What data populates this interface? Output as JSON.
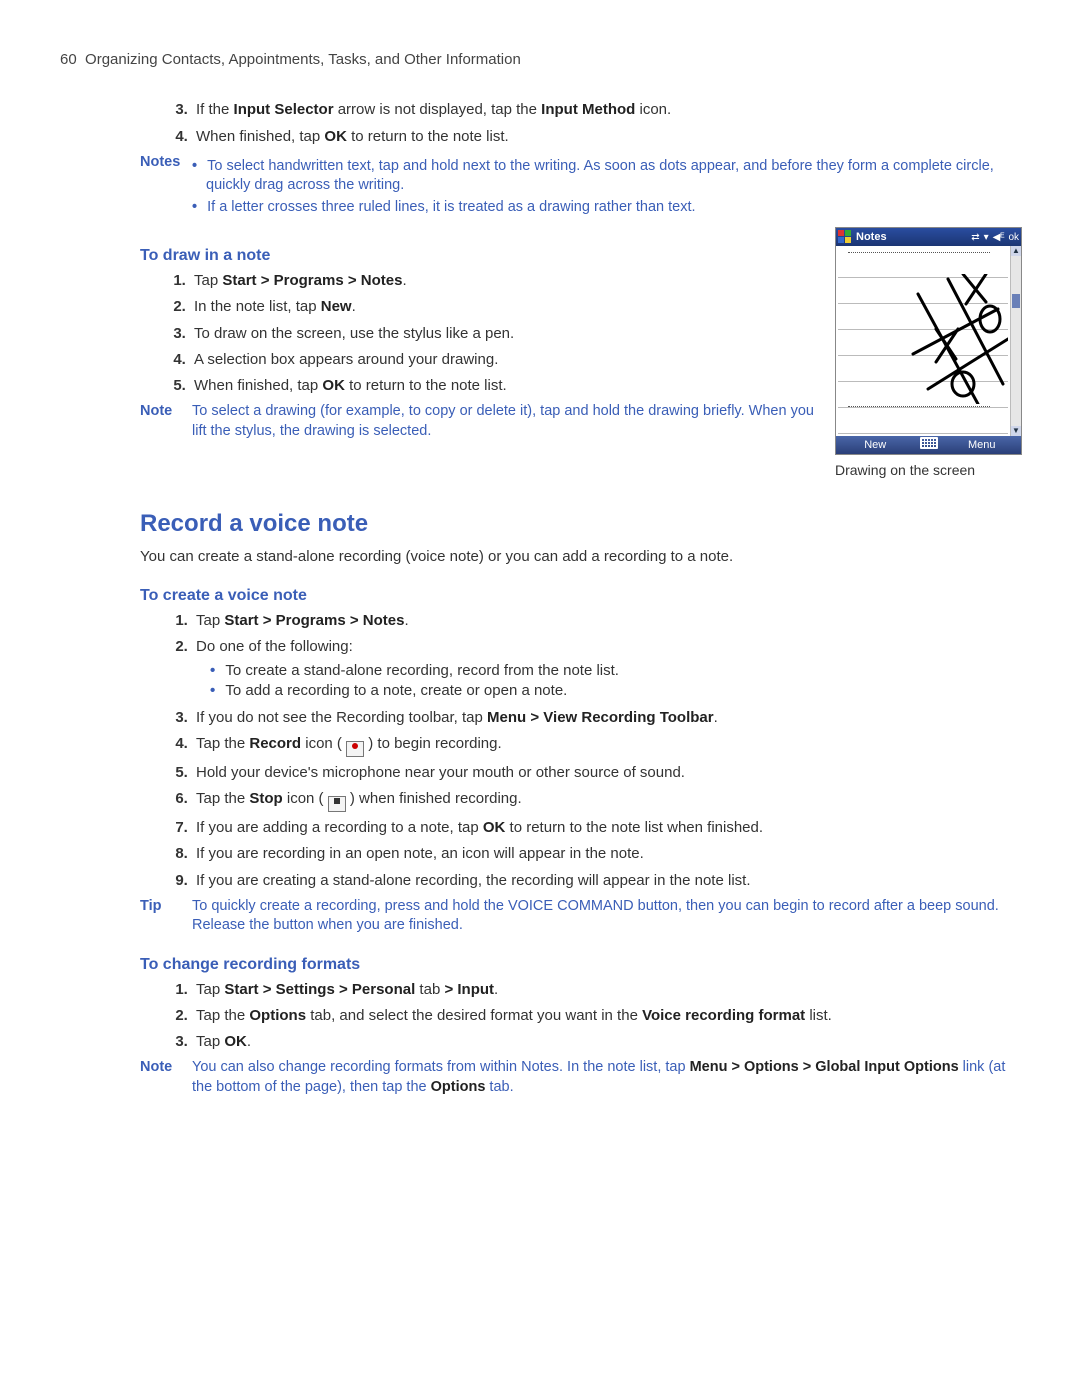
{
  "header": {
    "page_no": "60",
    "title": "Organizing Contacts, Appointments, Tasks, and Other Information"
  },
  "intro_steps": {
    "s3_a": "If the ",
    "s3_b": "Input Selector",
    "s3_c": " arrow is not displayed, tap the ",
    "s3_d": "Input Method",
    "s3_e": " icon.",
    "s4_a": "When finished, tap ",
    "s4_b": "OK",
    "s4_c": " to return to the note list."
  },
  "notes1": {
    "label": "Notes",
    "b1": "To select handwritten text, tap and hold next to the writing. As soon as dots appear, and before they form a complete circle, quickly drag across the writing.",
    "b2": "If a letter crosses three ruled lines, it is treated as a drawing rather than text."
  },
  "draw": {
    "heading": "To draw in a note",
    "s1_a": "Tap ",
    "s1_b": "Start > Programs > Notes",
    "s1_c": ".",
    "s2_a": "In the note list, tap ",
    "s2_b": "New",
    "s2_c": ".",
    "s3": "To draw on the screen, use the stylus like a pen.",
    "s4": "A selection box appears around your drawing.",
    "s5_a": "When finished, tap ",
    "s5_b": "OK",
    "s5_c": " to return to the note list."
  },
  "note2": {
    "label": "Note",
    "text": "To select a drawing (for example, to copy or delete it), tap and hold the drawing briefly. When you lift the stylus, the drawing is selected."
  },
  "device": {
    "title": "Notes",
    "ok": "ok",
    "new": "New",
    "menu": "Menu",
    "caption": "Drawing on the screen"
  },
  "record": {
    "heading": "Record a voice note",
    "intro": "You can create a stand-alone recording (voice note) or you can add a recording to a note."
  },
  "create": {
    "heading": "To create a voice note",
    "s1_a": "Tap ",
    "s1_b": "Start > Programs > Notes",
    "s1_c": ".",
    "s2": "Do one of the following:",
    "s2_b1": "To create a stand-alone recording, record from the note list.",
    "s2_b2": "To add a recording to a note, create or open a note.",
    "s3_a": "If you do not see the Recording toolbar, tap ",
    "s3_b": "Menu > View Recording Toolbar",
    "s3_c": ".",
    "s4_a": "Tap the ",
    "s4_b": "Record",
    "s4_c": " icon ( ",
    "s4_d": " ) to begin recording.",
    "s5": "Hold your device's microphone near your mouth or other source of sound.",
    "s6_a": "Tap the ",
    "s6_b": "Stop",
    "s6_c": " icon ( ",
    "s6_d": " ) when finished recording.",
    "s7_a": "If you are adding a recording to a note, tap ",
    "s7_b": "OK",
    "s7_c": " to return to the note list when finished.",
    "s8": "If you are recording in an open note, an icon will appear in the note.",
    "s9": "If you are creating a stand-alone recording, the recording will appear in the note list."
  },
  "tip": {
    "label": "Tip",
    "text": "To quickly create a recording, press and hold the VOICE COMMAND button, then you can begin to record after a beep sound. Release the button when you are finished."
  },
  "change": {
    "heading": "To change recording formats",
    "s1_a": "Tap ",
    "s1_b": "Start > Settings > Personal",
    "s1_c": " tab ",
    "s1_d": "> Input",
    "s1_e": ".",
    "s2_a": "Tap the ",
    "s2_b": "Options",
    "s2_c": " tab, and select the desired format you want in the ",
    "s2_d": "Voice recording format",
    "s2_e": " list.",
    "s3_a": "Tap ",
    "s3_b": "OK",
    "s3_c": "."
  },
  "note3": {
    "label": "Note",
    "a": "You can also change recording formats from within Notes. In the note list, tap ",
    "b": "Menu > Options > Global Input Options",
    "c": " link (at the bottom of the page), then tap the ",
    "d": "Options",
    "e": " tab."
  }
}
